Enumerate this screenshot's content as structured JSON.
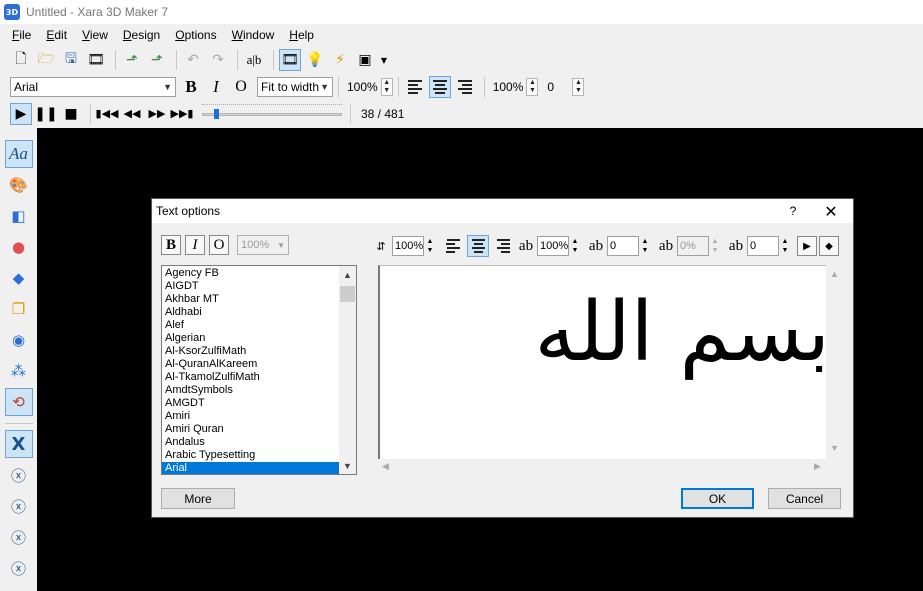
{
  "window": {
    "title": "Untitled - Xara 3D Maker 7",
    "app_icon": "3D"
  },
  "menu": [
    {
      "label": "File",
      "key": "F",
      "rest": "ile"
    },
    {
      "label": "Edit",
      "key": "E",
      "rest": "dit"
    },
    {
      "label": "View",
      "key": "V",
      "rest": "iew"
    },
    {
      "label": "Design",
      "key": "D",
      "rest": "esign"
    },
    {
      "label": "Options",
      "key": "O",
      "rest": "ptions"
    },
    {
      "label": "Window",
      "key": "W",
      "rest": "indow"
    },
    {
      "label": "Help",
      "key": "H",
      "rest": "elp"
    }
  ],
  "toolbar": {
    "font_name": "Arial",
    "bold": "B",
    "italic": "I",
    "outline": "O",
    "fit_mode": "Fit to width",
    "size_pct": "100%",
    "line_spacing_pct": "100%",
    "tracking": "0"
  },
  "playback": {
    "frame_counter": "38 / 481",
    "slider_fraction": 0.09
  },
  "dialog": {
    "title": "Text options",
    "help": "?",
    "bold": "B",
    "italic": "I",
    "outline": "O",
    "size_pct": "100%",
    "height_pct": "100%",
    "width_pct": "100%",
    "spacing_value": "0",
    "kerning_pct": "0%",
    "tracking_value": "0",
    "fonts": [
      "Agency FB",
      "AIGDT",
      "Akhbar MT",
      "Aldhabi",
      "Alef",
      "Algerian",
      "Al-KsorZulfiMath",
      "Al-QuranAlKareem",
      "Al-TkamolZulfiMath",
      "AmdtSymbols",
      "AMGDT",
      "Amiri",
      "Amiri Quran",
      "Andalus",
      "Arabic Typesetting",
      "Arial"
    ],
    "selected_font": "Arial",
    "preview_text": "بسم الله",
    "more_label": "More",
    "ok_label": "OK",
    "cancel_label": "Cancel"
  },
  "colors": {
    "accent": "#0078d7",
    "canvas": "#000000",
    "selection": "#cde4f7",
    "caret": "#e05050"
  }
}
